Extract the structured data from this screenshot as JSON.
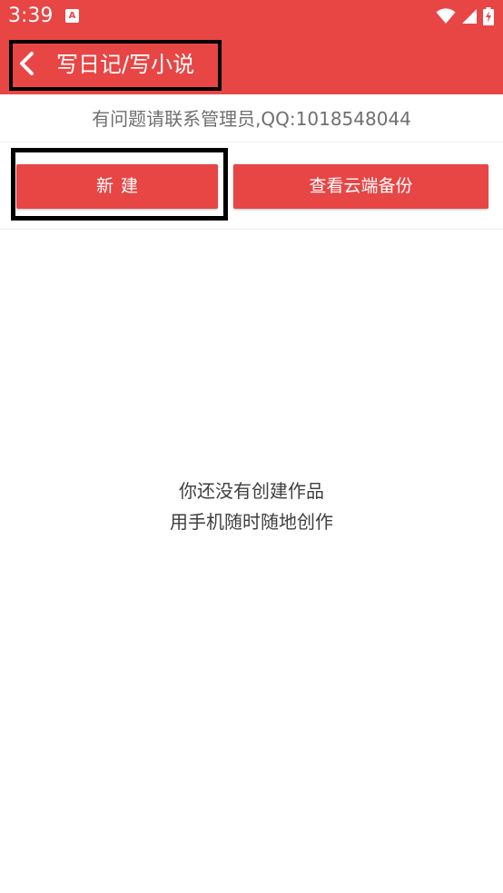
{
  "status_bar": {
    "time": "3:39",
    "notification_icon": "a-notification-icon",
    "wifi_icon": "wifi-icon",
    "signal_icon": "cell-signal-icon",
    "battery_icon": "battery-charging-icon"
  },
  "app_bar": {
    "back_icon": "chevron-left-icon",
    "title": "写日记/写小说"
  },
  "contact_text": "有问题请联系管理员,QQ:1018548044",
  "buttons": {
    "new_label": "新建",
    "cloud_backup_label": "查看云端备份"
  },
  "empty_state": {
    "line1": "你还没有创建作品",
    "line2": "用手机随时随地创作"
  },
  "colors": {
    "accent": "#e84545",
    "text_secondary": "#6f6f6f",
    "text_body": "#3f3f3f"
  }
}
